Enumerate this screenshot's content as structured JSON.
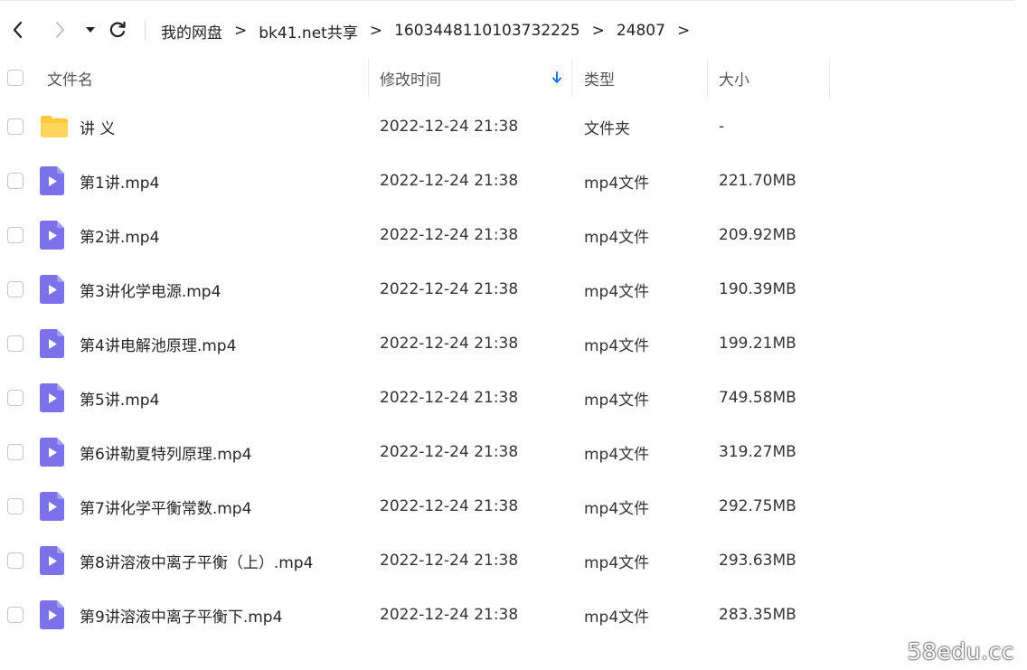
{
  "breadcrumb": {
    "items": [
      "我的网盘",
      "bk41.net共享",
      "1603448110103732225",
      "24807"
    ],
    "separator": ">"
  },
  "icons": {
    "back": "chevron-left-icon",
    "forward": "chevron-right-icon",
    "history": "caret-down-icon",
    "refresh": "refresh-icon",
    "sort": "arrow-down-icon",
    "folder": "folder-icon",
    "video": "video-file-icon"
  },
  "colors": {
    "accent": "#1a73e8",
    "folder": "#ffc93c",
    "video_file": "#7b72ea"
  },
  "table": {
    "columns": {
      "name": "文件名",
      "time": "修改时间",
      "type": "类型",
      "size": "大小"
    },
    "sort_column": "time",
    "sort_direction": "desc",
    "rows": [
      {
        "kind": "folder",
        "name": "讲 义",
        "time": "2022-12-24 21:38",
        "type": "文件夹",
        "size": "-"
      },
      {
        "kind": "video",
        "name": "第1讲.mp4",
        "time": "2022-12-24 21:38",
        "type": "mp4文件",
        "size": "221.70MB"
      },
      {
        "kind": "video",
        "name": "第2讲.mp4",
        "time": "2022-12-24 21:38",
        "type": "mp4文件",
        "size": "209.92MB"
      },
      {
        "kind": "video",
        "name": "第3讲化学电源.mp4",
        "time": "2022-12-24 21:38",
        "type": "mp4文件",
        "size": "190.39MB"
      },
      {
        "kind": "video",
        "name": "第4讲电解池原理.mp4",
        "time": "2022-12-24 21:38",
        "type": "mp4文件",
        "size": "199.21MB"
      },
      {
        "kind": "video",
        "name": "第5讲.mp4",
        "time": "2022-12-24 21:38",
        "type": "mp4文件",
        "size": "749.58MB"
      },
      {
        "kind": "video",
        "name": "第6讲勒夏特列原理.mp4",
        "time": "2022-12-24 21:38",
        "type": "mp4文件",
        "size": "319.27MB"
      },
      {
        "kind": "video",
        "name": "第7讲化学平衡常数.mp4",
        "time": "2022-12-24 21:38",
        "type": "mp4文件",
        "size": "292.75MB"
      },
      {
        "kind": "video",
        "name": "第8讲溶液中离子平衡（上）.mp4",
        "time": "2022-12-24 21:38",
        "type": "mp4文件",
        "size": "293.63MB"
      },
      {
        "kind": "video",
        "name": "第9讲溶液中离子平衡下.mp4",
        "time": "2022-12-24 21:38",
        "type": "mp4文件",
        "size": "283.35MB"
      }
    ]
  },
  "watermark": "58edu.cc"
}
